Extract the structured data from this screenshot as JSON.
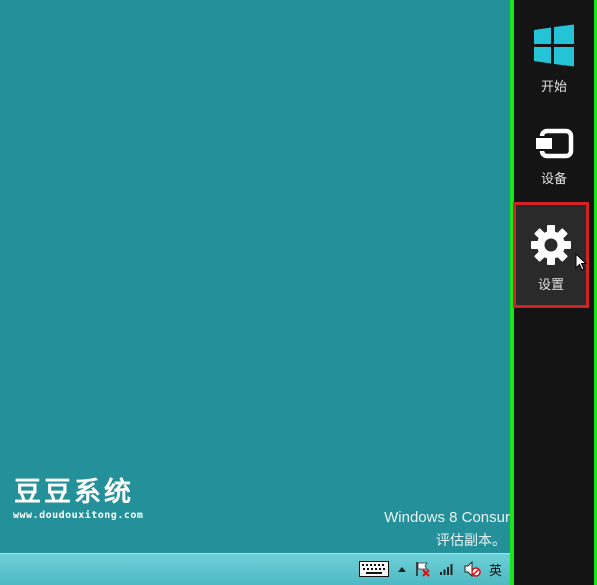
{
  "desktop": {
    "watermark_title": "豆豆系统",
    "watermark_url": "www.doudouxitong.com",
    "os_version": "Windows 8 Consur",
    "evaluation": "评估副本。"
  },
  "taskbar": {
    "ime_label": "英",
    "tray_icons": [
      "keyboard-icon",
      "show-hidden-icons-icon",
      "action-center-flag-icon",
      "network-signal-icon",
      "volume-muted-icon"
    ]
  },
  "charms": {
    "items": [
      {
        "label": "开始",
        "icon": "windows-logo-icon"
      },
      {
        "label": "设备",
        "icon": "devices-icon"
      },
      {
        "label": "设置",
        "icon": "gear-icon"
      }
    ],
    "accent_color": "#19e619",
    "highlight_color": "#d12323"
  }
}
